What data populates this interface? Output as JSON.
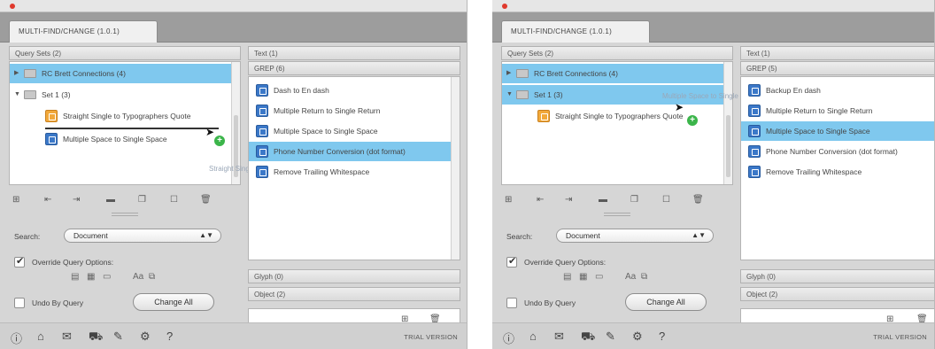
{
  "panels": [
    {
      "tab_title": "MULTI-FIND/CHANGE (1.0.1)",
      "left": {
        "header": "Query Sets (2)",
        "tree": [
          {
            "label": "RC Brett Connections (4)",
            "selected": true
          },
          {
            "label": "Set 1 (3)",
            "selected": false
          },
          {
            "label": "Straight Single to Typographers Quote",
            "selected": false
          },
          {
            "label": "Multiple Space to Single Space",
            "selected": false
          }
        ],
        "search_label": "Search:",
        "search_value": "Document",
        "override_label": "Override Query Options:",
        "undo_label": "Undo By Query",
        "change_all_label": "Change All"
      },
      "right": {
        "header_text": "Text (1)",
        "header_grep": "GREP (6)",
        "items": [
          {
            "label": "Dash to En dash",
            "selected": false
          },
          {
            "label": "Multiple Return to Single Return",
            "selected": false
          },
          {
            "label": "Multiple Space to Single Space",
            "selected": false
          },
          {
            "label": "Phone Number Conversion (dot format)",
            "selected": true
          },
          {
            "label": "Remove Trailing Whitespace",
            "selected": false
          }
        ],
        "header_glyph": "Glyph (0)",
        "header_object": "Object (2)"
      },
      "drag": {
        "ghost_label": "Straight Single to Typographers Quote"
      },
      "trial": "TRIAL VERSION"
    },
    {
      "tab_title": "MULTI-FIND/CHANGE (1.0.1)",
      "left": {
        "header": "Query Sets (2)",
        "tree": [
          {
            "label": "RC Brett Connections (4)",
            "selected": true
          },
          {
            "label": "Set 1 (3)",
            "selected": true
          },
          {
            "label": "Straight Single to Typographers Quote",
            "selected": false
          }
        ],
        "search_label": "Search:",
        "search_value": "Document",
        "override_label": "Override Query Options:",
        "undo_label": "Undo By Query",
        "change_all_label": "Change All"
      },
      "right": {
        "header_text": "Text (1)",
        "header_grep": "GREP (5)",
        "items": [
          {
            "label": "Backup En dash",
            "selected": false
          },
          {
            "label": "Multiple Return to Single Return",
            "selected": false
          },
          {
            "label": "Multiple Space to Single Space",
            "selected": true
          },
          {
            "label": "Phone Number Conversion (dot format)",
            "selected": false
          },
          {
            "label": "Remove Trailing Whitespace",
            "selected": false
          }
        ],
        "header_glyph": "Glyph (0)",
        "header_object": "Object (2)"
      },
      "drag": {
        "ghost_label": "Multiple Space to Single Space"
      },
      "trial": "TRIAL VERSION"
    }
  ],
  "icons": {
    "bottom": [
      "info-icon",
      "home-icon",
      "mail-icon",
      "cart-icon",
      "wrench-icon",
      "gear-icon",
      "help-icon"
    ],
    "query_toolbar": [
      "new-query-icon",
      "import-icon",
      "export-icon",
      "folder-icon",
      "duplicate-icon",
      "group-icon",
      "delete-icon"
    ],
    "options": [
      "case-icon",
      "word-icon",
      "layers-icon",
      "font-icon",
      "preview-icon"
    ]
  },
  "colors": {
    "selection": "#7fc8ee",
    "query_icon": "#3b78c8",
    "query_icon_active": "#f2a93b",
    "add_badge": "#3bb54a"
  }
}
